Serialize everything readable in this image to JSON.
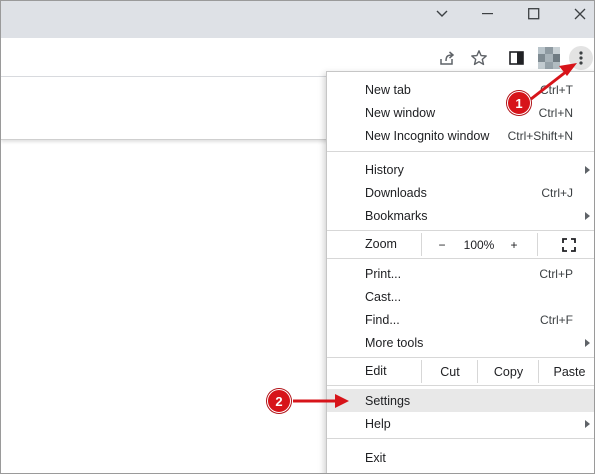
{
  "window_controls": {
    "minimize_icon": "minimize-icon",
    "restore_icon": "restore-icon",
    "close_icon": "close-icon",
    "tabsearch_icon": "chevron-down-icon"
  },
  "toolbar": {
    "icons": [
      "share-icon",
      "star-icon",
      "side-panel-icon",
      "profile-avatar",
      "kebab-menu-icon"
    ]
  },
  "menu": {
    "new_tab": {
      "label": "New tab",
      "shortcut": "Ctrl+T"
    },
    "new_window": {
      "label": "New window",
      "shortcut": "Ctrl+N"
    },
    "incognito": {
      "label": "New Incognito window",
      "shortcut": "Ctrl+Shift+N"
    },
    "history": {
      "label": "History"
    },
    "downloads": {
      "label": "Downloads",
      "shortcut": "Ctrl+J"
    },
    "bookmarks": {
      "label": "Bookmarks"
    },
    "zoom": {
      "label": "Zoom",
      "minus": "−",
      "value": "100%",
      "plus": "+"
    },
    "print": {
      "label": "Print...",
      "shortcut": "Ctrl+P"
    },
    "cast": {
      "label": "Cast..."
    },
    "find": {
      "label": "Find...",
      "shortcut": "Ctrl+F"
    },
    "more_tools": {
      "label": "More tools"
    },
    "edit": {
      "label": "Edit",
      "cut": "Cut",
      "copy": "Copy",
      "paste": "Paste"
    },
    "settings": {
      "label": "Settings"
    },
    "help": {
      "label": "Help"
    },
    "exit": {
      "label": "Exit"
    }
  },
  "annotations": {
    "step1": "1",
    "step2": "2",
    "arrow_color": "#d7141a"
  },
  "colors": {
    "titlebar": "#dee1e6",
    "highlight": "#e8e8e8",
    "badge": "#d7141a"
  }
}
